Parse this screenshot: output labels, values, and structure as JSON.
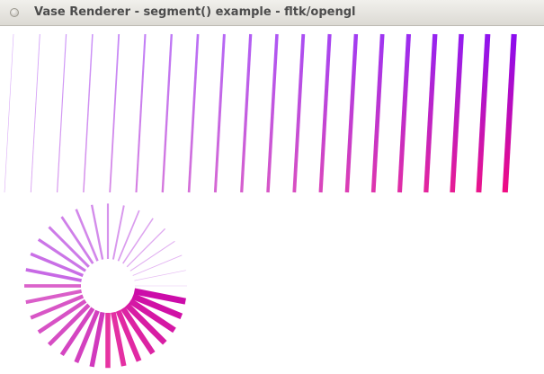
{
  "window": {
    "title": "Vase Renderer - segment() example - fltk/opengl"
  },
  "colors": {
    "start": "#8a0cf0",
    "end": "#f00c82",
    "background": "#ffffff",
    "titlebar": "#e3e1dc"
  },
  "demo": {
    "parallel_line_count": 20,
    "radial_segment_count": 32
  }
}
